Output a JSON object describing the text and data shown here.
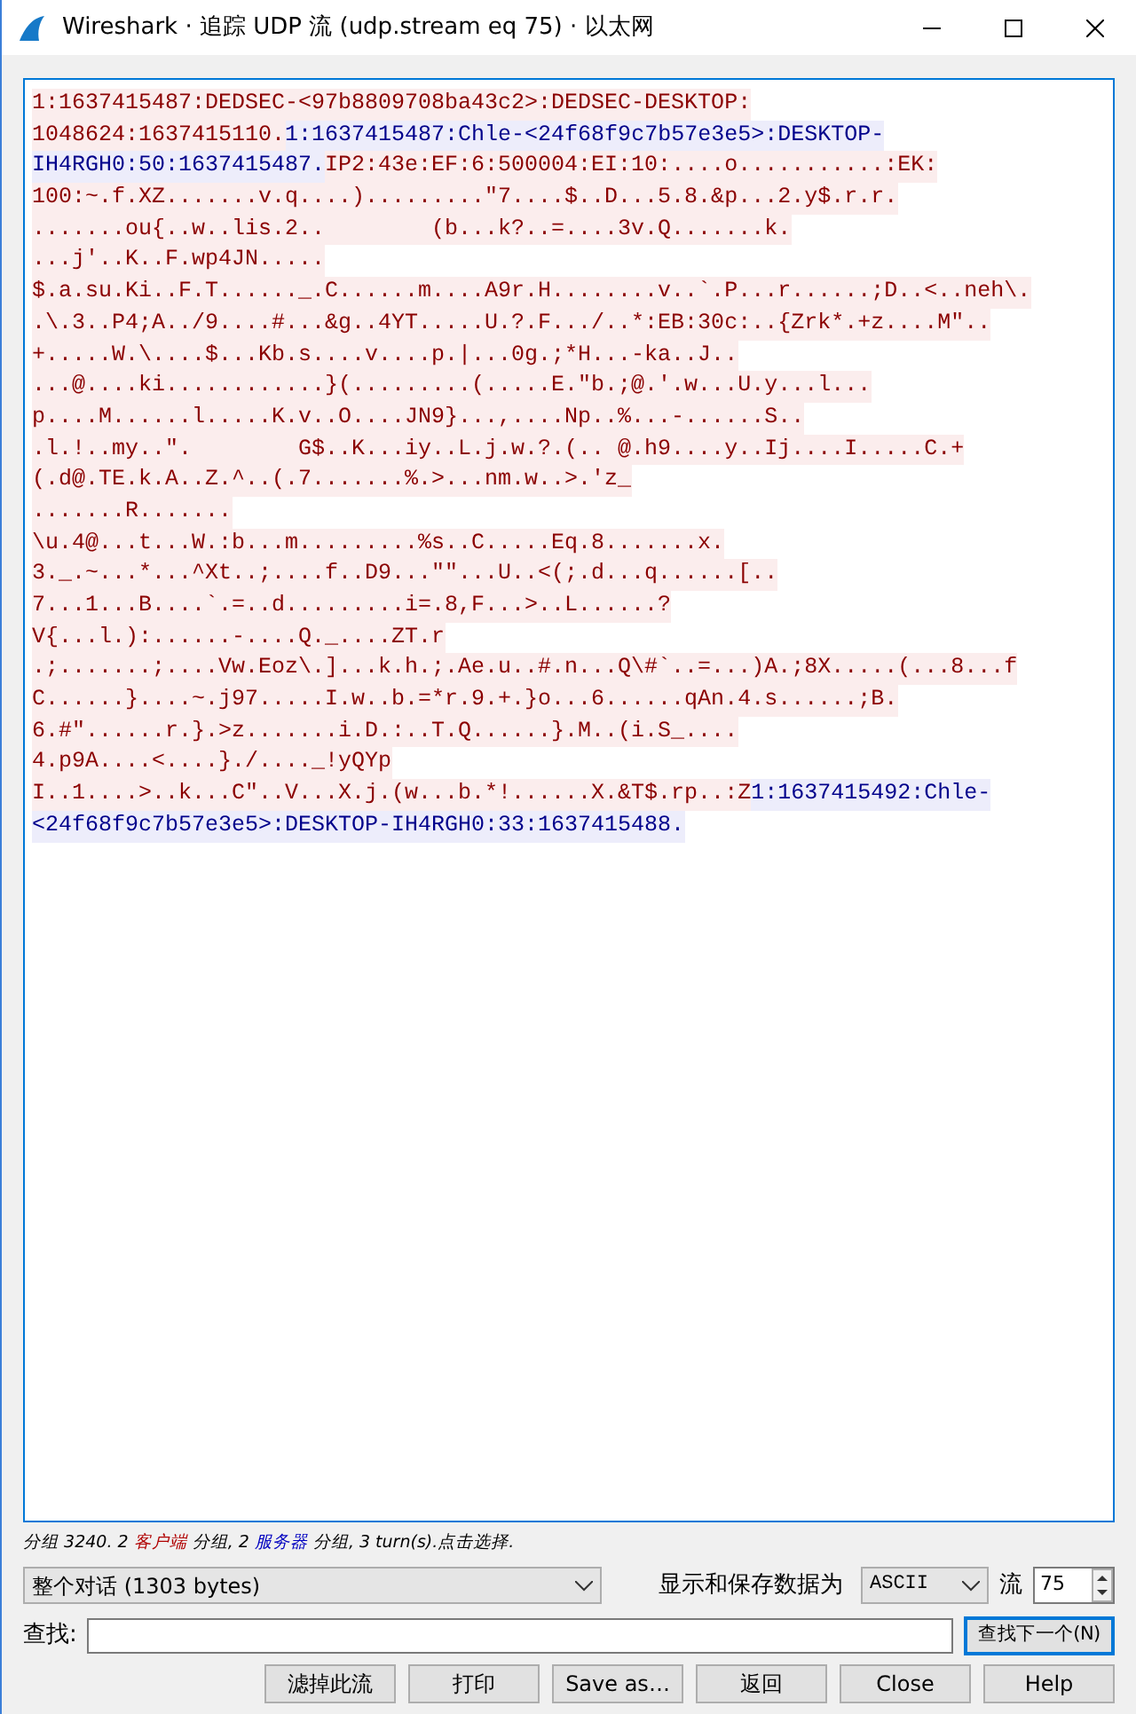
{
  "window": {
    "title": "Wireshark · 追踪 UDP 流 (udp.stream eq 75) · 以太网"
  },
  "stream_text": {
    "lines": [
      [
        {
          "kind": "client",
          "text": "1:1637415487:DEDSEC-<97b8809708ba43c2>:DEDSEC-DESKTOP:"
        }
      ],
      [
        {
          "kind": "client",
          "text": "1048624:1637415110."
        },
        {
          "kind": "server",
          "text": "1:1637415487:Chle-<24f68f9c7b57e3e5>:DESKTOP-"
        }
      ],
      [
        {
          "kind": "server",
          "text": "IH4RGH0:50:1637415487."
        },
        {
          "kind": "client",
          "text": "IP2:43e:EF:6:500004:EI:10:....o...........:EK:"
        }
      ],
      [
        {
          "kind": "client",
          "text": "100:~.f.XZ.......v.q....).........\"7....$..D...5.8.&p...2.y$.r.r."
        }
      ],
      [
        {
          "kind": "client",
          "text": ".......ou{..w..lis.2..        (b...k?..=....3v.Q.......k."
        }
      ],
      [
        {
          "kind": "client",
          "text": "...j'..K..F.wp4JN....."
        }
      ],
      [
        {
          "kind": "client",
          "text": "$.a.su.Ki..F.T......_.C......m....A9r.H........v..`.P...r......;D..<..neh\\."
        }
      ],
      [
        {
          "kind": "client",
          "text": ".\\.3..P4;A../9....#...&g..4YT.....U.?.F.../..*:EB:30c:..{Zrk*.+z....M\".."
        }
      ],
      [
        {
          "kind": "client",
          "text": "+.....W.\\....$...Kb.s....v....p.|...0g.;*H...-ka..J.."
        }
      ],
      [
        {
          "kind": "client",
          "text": "...@....ki............}(.........(.....E.\"b.;@.'.w...U.y...l..."
        }
      ],
      [
        {
          "kind": "client",
          "text": "p....M......l.....K.v..O....JN9}...,....Np..%...-......S.."
        }
      ],
      [
        {
          "kind": "client",
          "text": ".l.!..my..\".        G$..K...iy..L.j.w.?.(.. @.h9....y..Ij....I.....C.+"
        }
      ],
      [
        {
          "kind": "client",
          "text": "(.d@.TE.k.A..Z.^..(.7.......%.>...nm.w..>.'z_"
        }
      ],
      [
        {
          "kind": "client",
          "text": ".......R......."
        }
      ],
      [
        {
          "kind": "client",
          "text": "\\u.4@...t...W.:b...m.........%s..C.....Eq.8.......x."
        }
      ],
      [
        {
          "kind": "client",
          "text": "3._.~...*...^Xt..;....f..D9...\"\"...U..<(;.d...q......[.."
        }
      ],
      [
        {
          "kind": "client",
          "text": "7...1...B....`.=..d.........i=.8,F...>..L......?"
        }
      ],
      [
        {
          "kind": "client",
          "text": "V{...l.):......-....Q._....ZT.r"
        }
      ],
      [
        {
          "kind": "client",
          "text": ".;.......;....Vw.Eoz\\.]...k.h.;.Ae.u..#.n...Q\\#`..=...)A.;8X.....(...8...f"
        }
      ],
      [
        {
          "kind": "client",
          "text": "C......}....~.j97.....I.w..b.=*r.9.+.}o...6......qAn.4.s......;B."
        }
      ],
      [
        {
          "kind": "client",
          "text": "6.#\"......r.}.>z.......i.D.:..T.Q......}.M..(i.S_...."
        }
      ],
      [
        {
          "kind": "client",
          "text": "4.p9A....<....}./...._!yQYp"
        }
      ],
      [
        {
          "kind": "client",
          "text": "I..1....>..k...C\"..V...X.j.(w...b.*!......X.&T$.rp..:Z"
        },
        {
          "kind": "server",
          "text": "1:1637415492:Chle-"
        }
      ],
      [
        {
          "kind": "server",
          "text": "<24f68f9c7b57e3e5>:DESKTOP-IH4RGH0:33:1637415488."
        }
      ]
    ]
  },
  "summary": [
    {
      "kind": "plain",
      "text": "分组 3240. 2 "
    },
    {
      "kind": "client",
      "text": "客户端"
    },
    {
      "kind": "plain",
      "text": " 分组, 2 "
    },
    {
      "kind": "server",
      "text": "服务器"
    },
    {
      "kind": "plain",
      "text": " 分组, 3 turn(s).点击选择."
    }
  ],
  "conversation_select": {
    "value": "整个对话 (1303 bytes)"
  },
  "show_as": {
    "label": "显示和保存数据为",
    "value": "ASCII"
  },
  "stream": {
    "label": "流",
    "value": "75"
  },
  "find": {
    "label": "查找:",
    "button": "查找下一个(N)"
  },
  "buttons": [
    "滤掉此流",
    "打印",
    "Save as…",
    "返回",
    "Close",
    "Help"
  ]
}
